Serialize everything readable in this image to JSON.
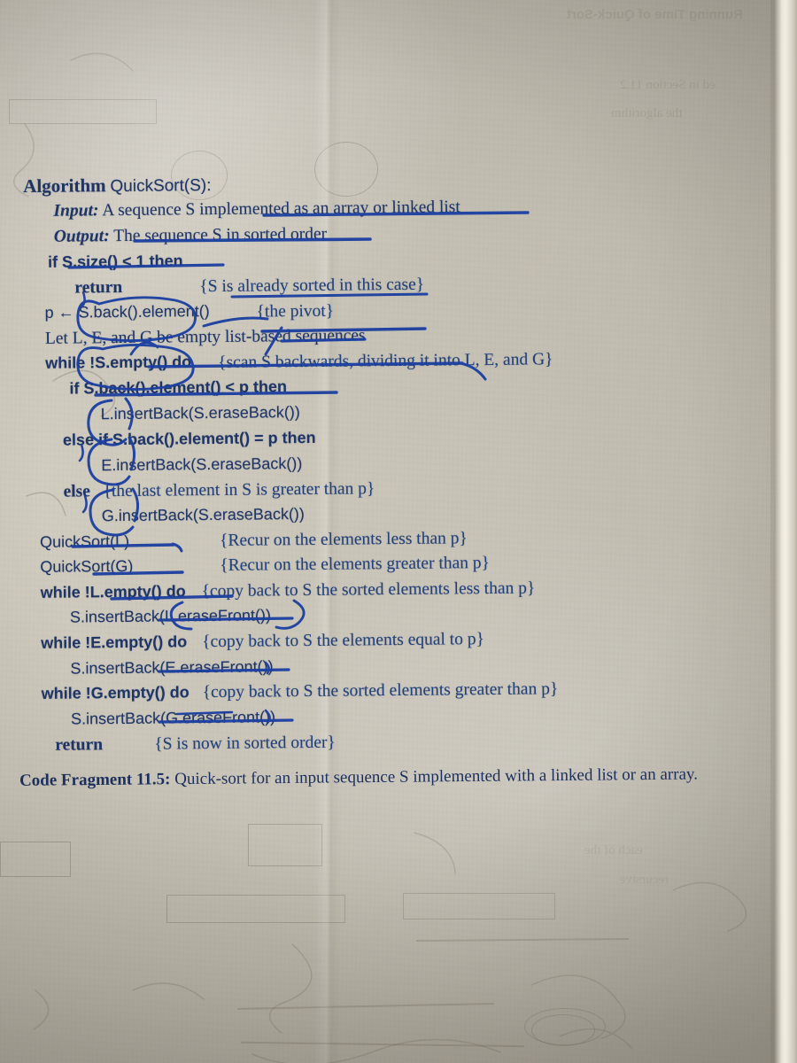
{
  "document": {
    "kind": "textbook-page-photo",
    "surface": "paper",
    "ink_color": "#1f3566",
    "annotation_color": "#1b3fa0",
    "paper_color": "#cdc8bb"
  },
  "algorithm": {
    "header": {
      "keyword": "Algorithm",
      "signature": "QuickSort(S):"
    },
    "io": [
      {
        "label": "Input:",
        "text": "A sequence S implemented as an array or linked list"
      },
      {
        "label": "Output:",
        "text": "The sequence S in sorted order"
      }
    ],
    "lines": [
      {
        "id": "l01",
        "indent": 1,
        "text": "if S.size() < 1 then"
      },
      {
        "id": "l02",
        "indent": 2,
        "text": "return",
        "comment": "{S is already sorted in this case}"
      },
      {
        "id": "l03",
        "indent": 1,
        "text": "p ← S.back().element()",
        "comment": "{the pivot}"
      },
      {
        "id": "l04",
        "indent": 1,
        "text": "Let L, E, and G be empty list-based sequences"
      },
      {
        "id": "l05",
        "indent": 1,
        "text": "while !S.empty() do",
        "comment": "{scan S backwards, dividing it into L, E, and G}"
      },
      {
        "id": "l06",
        "indent": 2,
        "text": "if S.back().element() < p then"
      },
      {
        "id": "l07",
        "indent": 3,
        "text": "L.insertBack(S.eraseBack())"
      },
      {
        "id": "l08",
        "indent": 2,
        "text": "else if S.back().element() = p then"
      },
      {
        "id": "l09",
        "indent": 3,
        "text": "E.insertBack(S.eraseBack())"
      },
      {
        "id": "l10",
        "indent": 2,
        "text": "else",
        "comment": "{the last element in S is greater than p}"
      },
      {
        "id": "l11",
        "indent": 3,
        "text": "G.insertBack(S.eraseBack())"
      },
      {
        "id": "l12",
        "indent": 1,
        "text": "QuickSort(L)",
        "comment": "{Recur on the elements less than p}"
      },
      {
        "id": "l13",
        "indent": 1,
        "text": "QuickSort(G)",
        "comment": "{Recur on the elements greater than p}"
      },
      {
        "id": "l14",
        "indent": 1,
        "text": "while !L.empty() do",
        "comment": "{copy back to S the sorted elements less than p}"
      },
      {
        "id": "l15",
        "indent": 2,
        "text": "S.insertBack(L.eraseFront())"
      },
      {
        "id": "l16",
        "indent": 1,
        "text": "while !E.empty() do",
        "comment": "{copy back to S the elements equal to p}"
      },
      {
        "id": "l17",
        "indent": 2,
        "text": "S.insertBack(E.eraseFront())"
      },
      {
        "id": "l18",
        "indent": 1,
        "text": "while !G.empty() do",
        "comment": "{copy back to S the sorted elements greater than p}"
      },
      {
        "id": "l19",
        "indent": 2,
        "text": "S.insertBack(G.eraseFront())"
      },
      {
        "id": "l20",
        "indent": 1,
        "text": "return",
        "comment": "{S is now in sorted order}"
      }
    ]
  },
  "caption": {
    "label": "Code Fragment 11.5:",
    "text": "Quick-sort for an input sequence S implemented with a linked list or an array."
  },
  "annotations": {
    "underlines": [
      "an array or linked list",
      "The sequence S in sorted order",
      "S.size() < 1 then",
      "{S is already sorted in this case}",
      "S.back().element()",
      "empty list-based sequences",
      "S.back().element() < p then",
      "QuickSort(L)",
      "QuickSort(G)",
      "!L.empty() do",
      "L.eraseFront()",
      "E.eraseFront()",
      "G.eraseFront()"
    ],
    "circles": [
      "S.back()",
      "!S.empty",
      "L.",
      "E.",
      "G.",
      "L.eraseFront())"
    ],
    "strikes": [
      "list-based"
    ]
  },
  "bleed_through": {
    "note": "faint mirrored text and pencil marks showing through from the reverse side",
    "top_line": "Running Time of Quick-Sort",
    "fragments": [
      "ed in Section 11.2",
      "the algorithm",
      "each of the",
      "recursive"
    ]
  }
}
